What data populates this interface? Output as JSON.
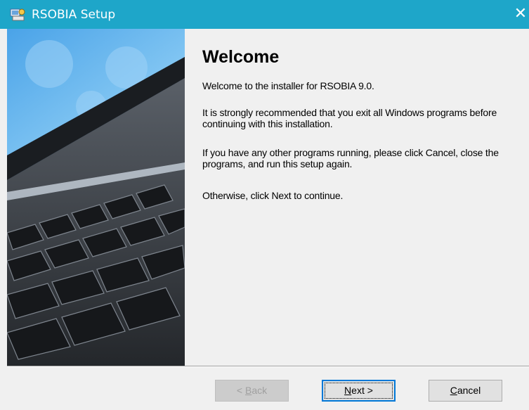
{
  "window": {
    "title": "RSOBIA Setup",
    "close_glyph": "✕"
  },
  "content": {
    "heading": "Welcome",
    "p1": "Welcome to the installer for RSOBIA 9.0.",
    "p2": "It is strongly recommended that you exit all Windows programs before continuing with this installation.",
    "p3": "If you have any other programs running, please click Cancel, close the programs, and run this setup again.",
    "p4": "Otherwise, click Next to continue."
  },
  "buttons": {
    "back": {
      "accel": "B",
      "rest": "ack",
      "prefix": "< ",
      "suffix": "",
      "enabled": false
    },
    "next": {
      "accel": "N",
      "rest": "ext",
      "prefix": "",
      "suffix": " >",
      "enabled": true
    },
    "cancel": {
      "accel": "C",
      "rest": "ancel",
      "prefix": "",
      "suffix": "",
      "enabled": true
    }
  },
  "colors": {
    "titlebar": "#1ea6c9",
    "accent": "#0078d7",
    "face": "#f0f0f0"
  },
  "icons": {
    "app": "installer-icon",
    "sidebar": "laptop-keyboard-image"
  }
}
